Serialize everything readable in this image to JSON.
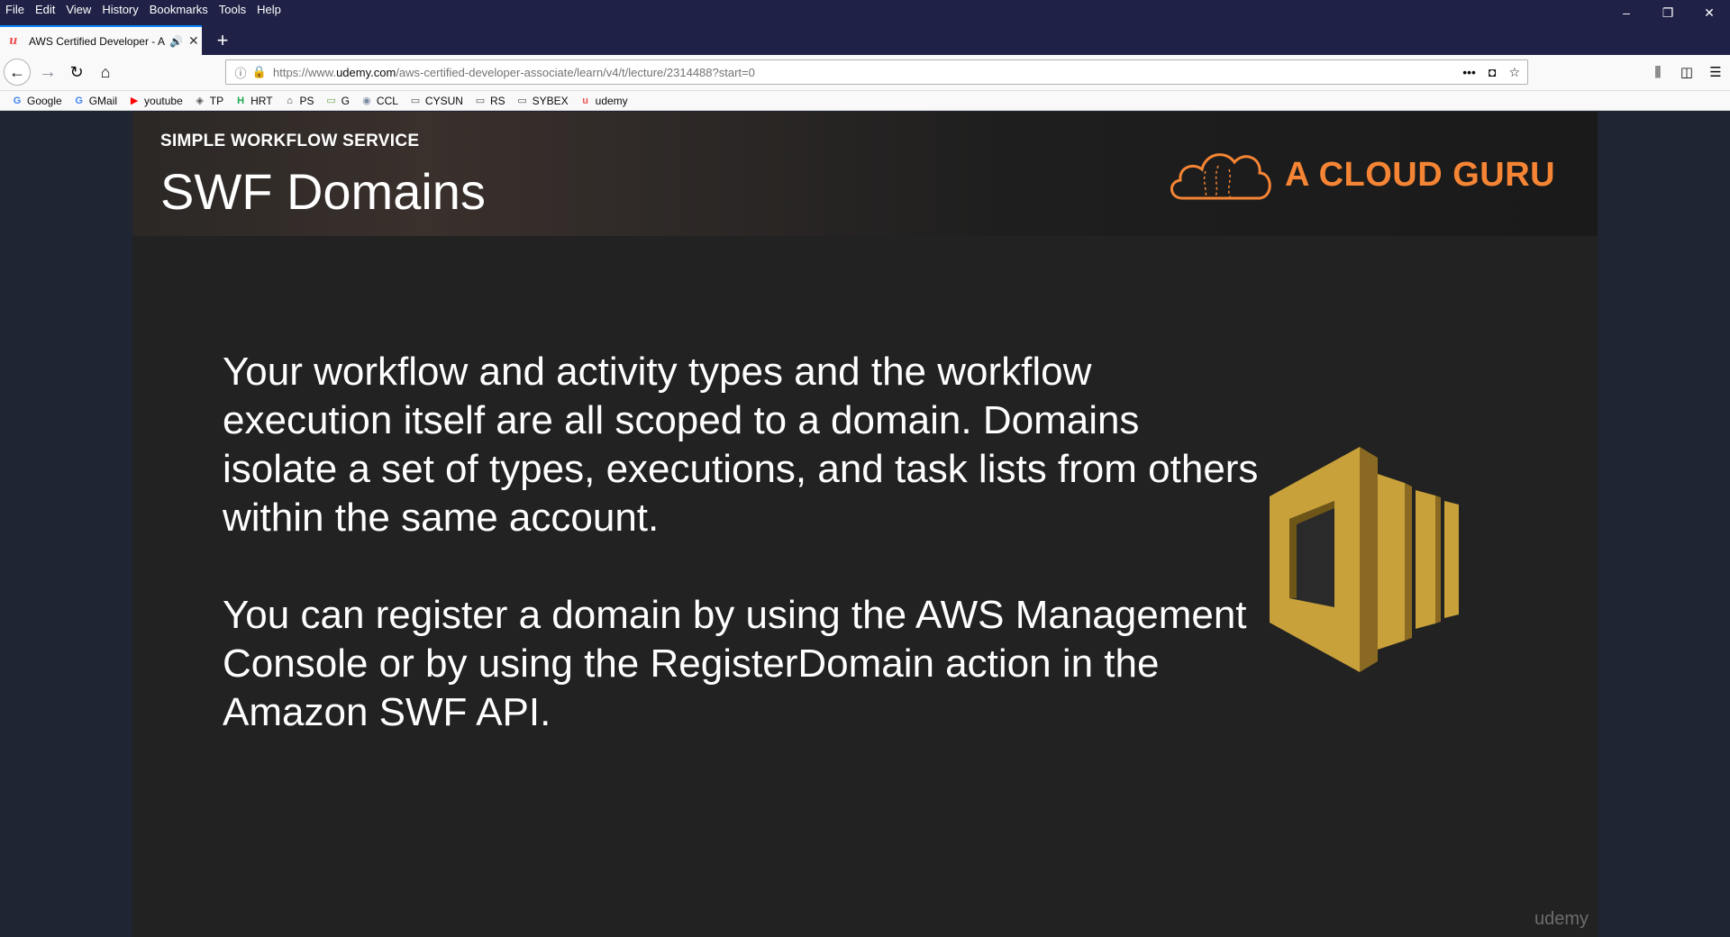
{
  "menu": [
    "File",
    "Edit",
    "View",
    "History",
    "Bookmarks",
    "Tools",
    "Help"
  ],
  "window_controls": {
    "minimize": "–",
    "restore": "❐",
    "close": "✕"
  },
  "tab": {
    "title": "AWS Certified Developer - A",
    "favicon": "udemy-icon"
  },
  "new_tab_label": "+",
  "address": {
    "prefix": "https://www.",
    "host": "udemy.com",
    "path": "/aws-certified-developer-associate/learn/v4/t/lecture/2314488?start=0"
  },
  "bookmarks": [
    {
      "label": "Google",
      "icon": "G",
      "color": "#4285f4"
    },
    {
      "label": "GMail",
      "icon": "G",
      "color": "#4285f4"
    },
    {
      "label": "youtube",
      "icon": "▶",
      "color": "#ff0000"
    },
    {
      "label": "TP",
      "icon": "◈",
      "color": "#555555"
    },
    {
      "label": "HRT",
      "icon": "H",
      "color": "#1ba94c"
    },
    {
      "label": "PS",
      "icon": "⌂",
      "color": "#333333"
    },
    {
      "label": "G",
      "icon": "▭",
      "color": "#6aa84f"
    },
    {
      "label": "CCL",
      "icon": "◉",
      "color": "#7a8aa0"
    },
    {
      "label": "CYSUN",
      "icon": "▭",
      "color": "#555555"
    },
    {
      "label": "RS",
      "icon": "▭",
      "color": "#555555"
    },
    {
      "label": "SYBEX",
      "icon": "▭",
      "color": "#555555"
    },
    {
      "label": "udemy",
      "icon": "u",
      "color": "#ec5252"
    }
  ],
  "slide": {
    "kicker": "SIMPLE WORKFLOW SERVICE",
    "title": "SWF Domains",
    "brand": "A CLOUD GURU",
    "paragraphs": [
      "Your workflow and activity types and the workflow execution itself are all scoped to a domain. Domains isolate a set of types, executions, and task lists from others within the same account.",
      "You can register a domain by using the AWS Management Console or by using the RegisterDomain action in the Amazon SWF API."
    ],
    "watermark": "udemy"
  },
  "colors": {
    "brand_orange": "#f58534",
    "swf_gold": "#c9a13b"
  }
}
